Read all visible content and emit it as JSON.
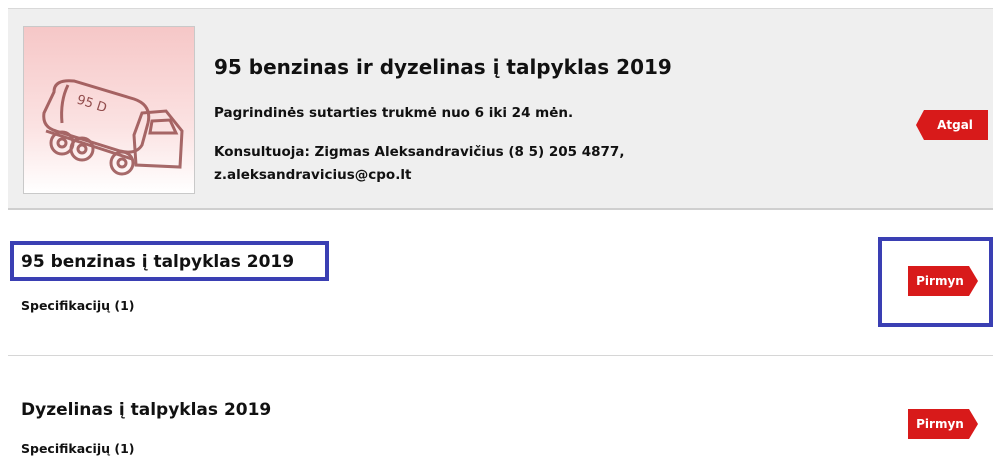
{
  "header": {
    "title": "95 benzinas ir dyzelinas į talpyklas 2019",
    "subtitle": "Pagrindinės sutarties trukmė nuo 6 iki 24 mėn.",
    "consult_line1": "Konsultuoja: Zigmas Aleksandravičius (8 5) 205 4877,",
    "consult_line2": "z.aleksandravicius@cpo.lt",
    "back_label": "Atgal",
    "tank_label": "95 D"
  },
  "items": [
    {
      "title": "95 benzinas į talpyklas 2019",
      "spec": "Specifikacijų (1)",
      "button": "Pirmyn"
    },
    {
      "title": "Dyzelinas į talpyklas 2019",
      "spec": "Specifikacijų (1)",
      "button": "Pirmyn"
    }
  ],
  "colors": {
    "accent_red": "#d81a1a",
    "highlight_blue": "#3a3fb3",
    "header_bg": "#efefef"
  },
  "icons": {
    "thumbnail": "fuel-tanker-truck-icon"
  }
}
